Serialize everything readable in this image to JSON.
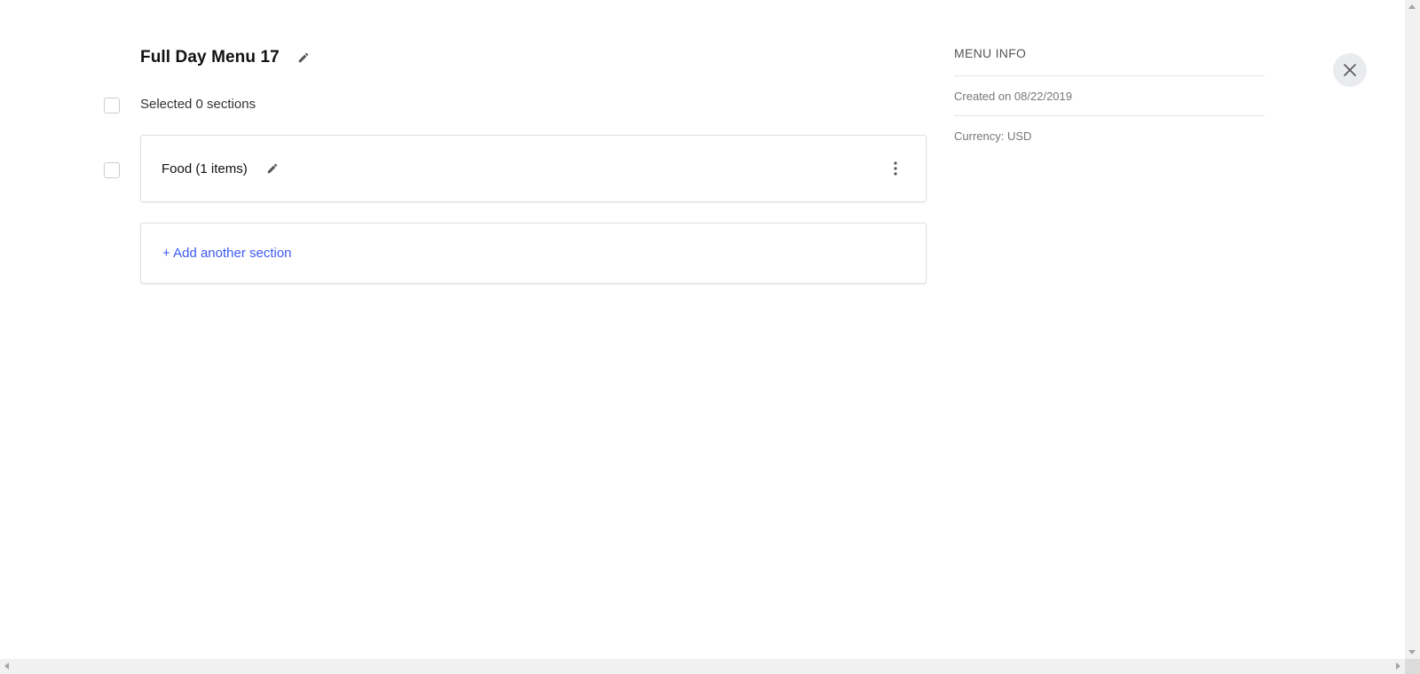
{
  "menu": {
    "title": "Full Day Menu 17",
    "edit_icon": "pencil-icon"
  },
  "selection": {
    "text": "Selected 0 sections",
    "checked": false
  },
  "sections": [
    {
      "name": "Food (1 items)",
      "checked": false,
      "edit_icon": "pencil-icon",
      "more_icon": "more-vertical-icon"
    }
  ],
  "add_section": {
    "label": "+ Add another section",
    "color": "#3d5af1"
  },
  "info": {
    "heading": "MENU INFO",
    "created": "Created on 08/22/2019",
    "currency": "Currency: USD"
  },
  "close": {
    "icon": "close-icon"
  }
}
